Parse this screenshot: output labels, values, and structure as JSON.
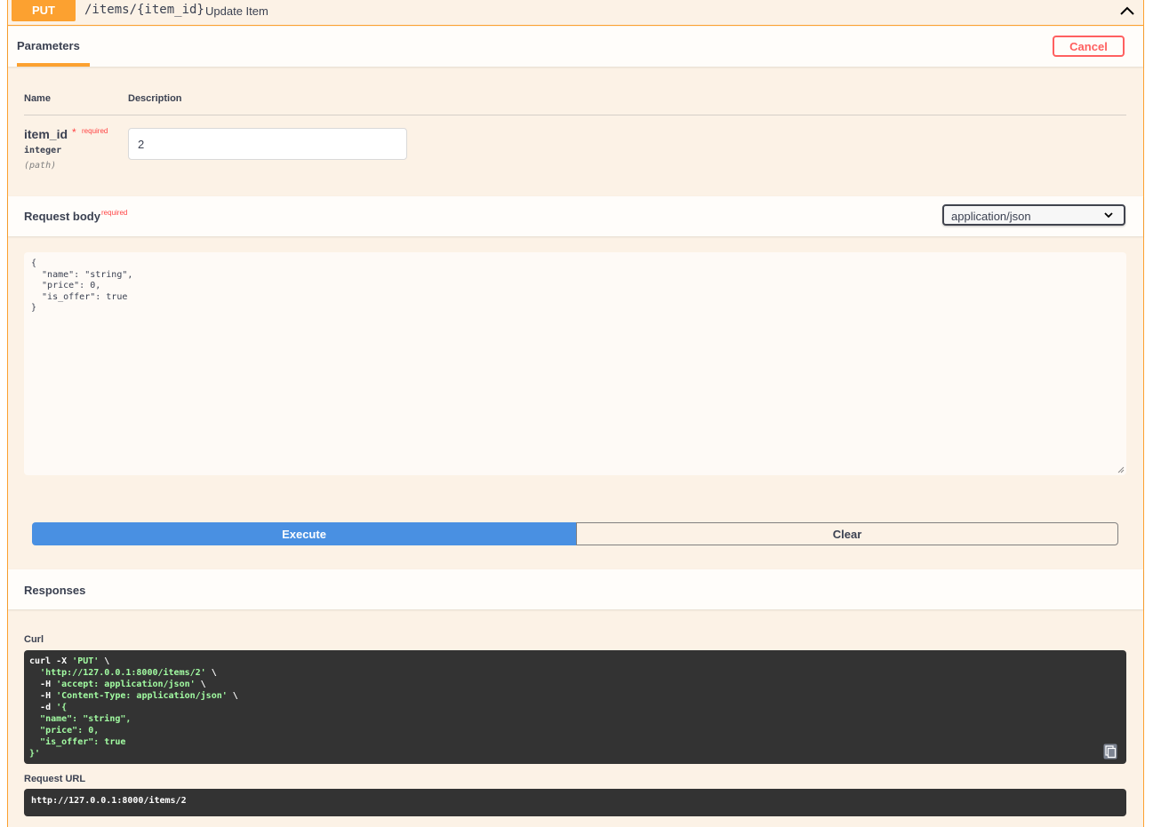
{
  "operation": {
    "method": "PUT",
    "path": "/items/{item_id}",
    "summary": "Update Item"
  },
  "parameters": {
    "tab_label": "Parameters",
    "cancel_label": "Cancel",
    "col_name": "Name",
    "col_description": "Description",
    "items": [
      {
        "name": "item_id",
        "required_star": "*",
        "required_label": "required",
        "type": "integer",
        "in": "(path)",
        "value": "2"
      }
    ]
  },
  "request_body": {
    "title": "Request body",
    "required_label": "required",
    "content_type": "application/json",
    "body": "{\n  \"name\": \"string\",\n  \"price\": 0,\n  \"is_offer\": true\n}"
  },
  "actions": {
    "execute_label": "Execute",
    "clear_label": "Clear"
  },
  "responses": {
    "title": "Responses",
    "curl_label": "Curl",
    "curl": {
      "cmd": "curl -X ",
      "method_quoted": "'PUT'",
      "line1_tail": " \\",
      "url_quoted": "'http://127.0.0.1:8000/items/2'",
      "h_flag": "-H ",
      "accept_header": "'accept: application/json'",
      "content_header": "'Content-Type: application/json'",
      "d_flag": "-d ",
      "body_open": "'{",
      "body_l1": "\"name\": \"string\",",
      "body_l2": "\"price\": 0,",
      "body_l3": "\"is_offer\": true",
      "body_close": "}'"
    },
    "request_url_label": "Request URL",
    "request_url": "http://127.0.0.1:8000/items/2"
  },
  "colors": {
    "put_accent": "#fca130",
    "execute": "#4990e2",
    "cancel": "#ff6060",
    "code_bg": "#333333"
  },
  "icons": {
    "collapse": "chevron-up-icon",
    "select": "chevron-down-icon",
    "copy": "clipboard-copy-icon"
  }
}
